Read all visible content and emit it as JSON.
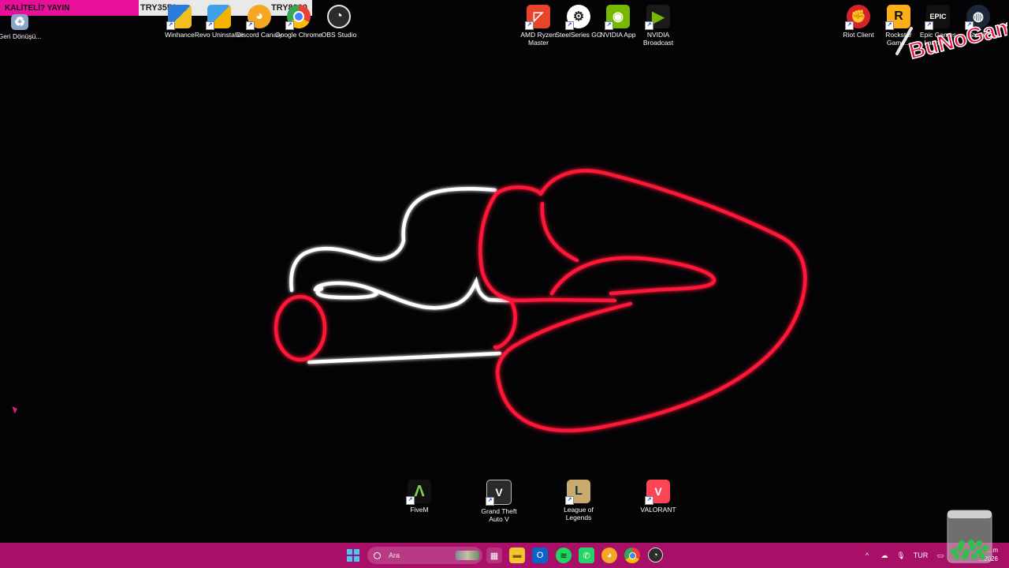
{
  "donation": {
    "label": "KALİTELİ? YAYIN",
    "current": "TRY3550",
    "goal": "TRY8000"
  },
  "desktop_icons_top_left": [
    {
      "label": "Geri Dönüşü...",
      "icon": "recycle-bin-icon"
    },
    {
      "label": "Winhance",
      "icon": "winhance-icon"
    },
    {
      "label": "Revo Uninstaller",
      "icon": "revo-uninstaller-icon"
    },
    {
      "label": "Discord Canary",
      "icon": "discord-canary-icon"
    },
    {
      "label": "Google Chrome",
      "icon": "chrome-icon"
    },
    {
      "label": "OBS Studio",
      "icon": "obs-icon"
    }
  ],
  "desktop_icons_top_center": [
    {
      "label": "AMD Ryzen Master",
      "icon": "amd-ryzen-master-icon"
    },
    {
      "label": "SteelSeries GG",
      "icon": "steelseries-gg-icon"
    },
    {
      "label": "NVIDIA App",
      "icon": "nvidia-app-icon"
    },
    {
      "label": "NVIDIA Broadcast",
      "icon": "nvidia-broadcast-icon"
    }
  ],
  "desktop_icons_top_right": [
    {
      "label": "Riot Client",
      "icon": "riot-client-icon"
    },
    {
      "label": "Rockstar Game...",
      "icon": "rockstar-launcher-icon"
    },
    {
      "label": "Epic Games Launcher",
      "icon": "epic-games-icon"
    },
    {
      "label": "Steam",
      "icon": "steam-icon"
    }
  ],
  "desktop_icons_bottom": [
    {
      "label": "FiveM",
      "icon": "fivem-icon"
    },
    {
      "label": "Grand Theft Auto V",
      "icon": "gta-v-icon"
    },
    {
      "label": "League of Legends",
      "icon": "league-of-legends-icon"
    },
    {
      "label": "VALORANT",
      "icon": "valorant-icon"
    }
  ],
  "watermark": {
    "text": "BuNoGam"
  },
  "taskbar": {
    "search_placeholder": "Ara",
    "apps": [
      {
        "name": "start-button",
        "icon": "windows-start-icon"
      },
      {
        "name": "task-view",
        "icon": "task-view-icon"
      },
      {
        "name": "file-explorer",
        "icon": "folder-icon"
      },
      {
        "name": "outlook",
        "icon": "outlook-icon"
      },
      {
        "name": "spotify",
        "icon": "spotify-icon"
      },
      {
        "name": "whatsapp",
        "icon": "whatsapp-icon"
      },
      {
        "name": "discord",
        "icon": "discord-icon"
      },
      {
        "name": "chrome",
        "icon": "chrome-icon"
      },
      {
        "name": "obs",
        "icon": "obs-icon"
      }
    ],
    "tray": {
      "language": "TUR",
      "time": "...m",
      "date": "...2026"
    }
  },
  "colors": {
    "taskbar": "#a80f67",
    "neon_red": "#ff1a3c",
    "neon_white": "#ffffff",
    "donation_accent": "#e8109a"
  }
}
